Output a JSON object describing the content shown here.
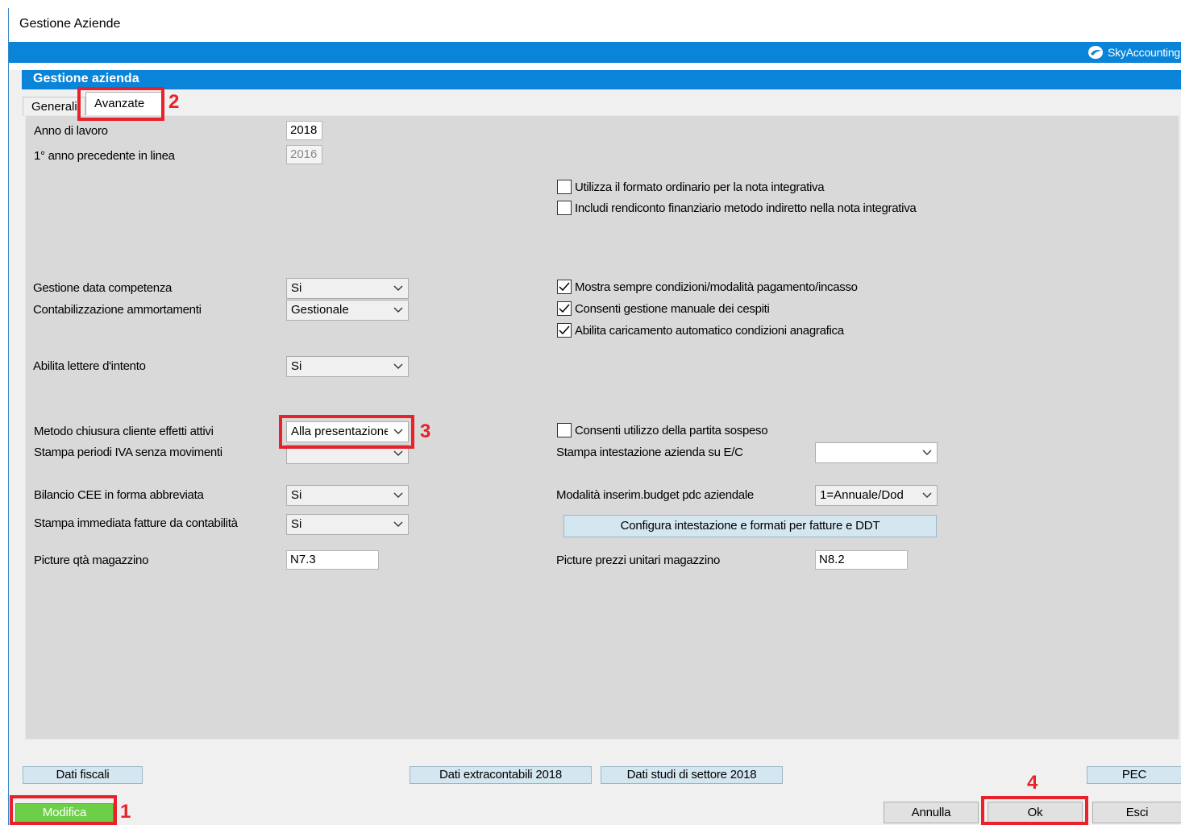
{
  "window": {
    "title": "Gestione Aziende"
  },
  "brand": {
    "name": "SkyAccounting",
    "color": "#0a84d8"
  },
  "section": {
    "title": "Gestione azienda"
  },
  "tabs": [
    {
      "label": "Generali"
    },
    {
      "label": "Avanzate",
      "active": true
    }
  ],
  "form": {
    "anno_lavoro": {
      "label": "Anno di lavoro",
      "value": "2018"
    },
    "anno_precedente": {
      "label": "1° anno precedente in linea",
      "value": "2016"
    },
    "gestione_data": {
      "label": "Gestione data competenza",
      "value": "Si"
    },
    "contabilizzazione": {
      "label": "Contabilizzazione ammortamenti",
      "value": "Gestionale"
    },
    "lettere_intento": {
      "label": "Abilita lettere d'intento",
      "value": "Si"
    },
    "metodo_chiusura": {
      "label": "Metodo chiusura cliente effetti attivi",
      "value": "Alla presentazione"
    },
    "stampa_periodi": {
      "label": "Stampa periodi IVA senza movimenti",
      "value": ""
    },
    "bilancio_cee": {
      "label": "Bilancio CEE in forma abbreviata",
      "value": "Si"
    },
    "stampa_immediata": {
      "label": "Stampa immediata fatture da contabilità",
      "value": "Si"
    },
    "picture_qta": {
      "label": "Picture qtà magazzino",
      "value": "N7.3"
    },
    "stampa_intestazione": {
      "label": "Stampa intestazione azienda su E/C",
      "value": ""
    },
    "modalita_budget": {
      "label": "Modalità inserim.budget pdc aziendale",
      "value": "1=Annuale/Dod"
    },
    "picture_prezzi": {
      "label": "Picture prezzi unitari magazzino",
      "value": "N8.2"
    }
  },
  "checkboxes": {
    "formato_ordinario": {
      "label": "Utilizza il formato ordinario per la nota integrativa",
      "checked": false
    },
    "rendiconto": {
      "label": "Includi rendiconto finanziario metodo indiretto nella nota integrativa",
      "checked": false
    },
    "mostra_condizioni": {
      "label": "Mostra sempre condizioni/modalità pagamento/incasso",
      "checked": true
    },
    "cespiti": {
      "label": "Consenti gestione manuale dei cespiti",
      "checked": true
    },
    "caricamento_auto": {
      "label": "Abilita caricamento automatico condizioni anagrafica",
      "checked": true
    },
    "partita_sospeso": {
      "label": "Consenti utilizzo della partita sospeso",
      "checked": false
    }
  },
  "buttons": {
    "configura": "Configura intestazione e formati per fatture e DDT",
    "dati_fiscali": "Dati fiscali",
    "extracontabili": "Dati extracontabili 2018",
    "studi_settore": "Dati studi di settore 2018",
    "pec": "PEC",
    "modifica": "Modifica",
    "annulla": "Annulla",
    "ok": "Ok",
    "esci": "Esci"
  },
  "annotations": {
    "n1": "1",
    "n2": "2",
    "n3": "3",
    "n4": "4",
    "color": "#e8212b"
  }
}
